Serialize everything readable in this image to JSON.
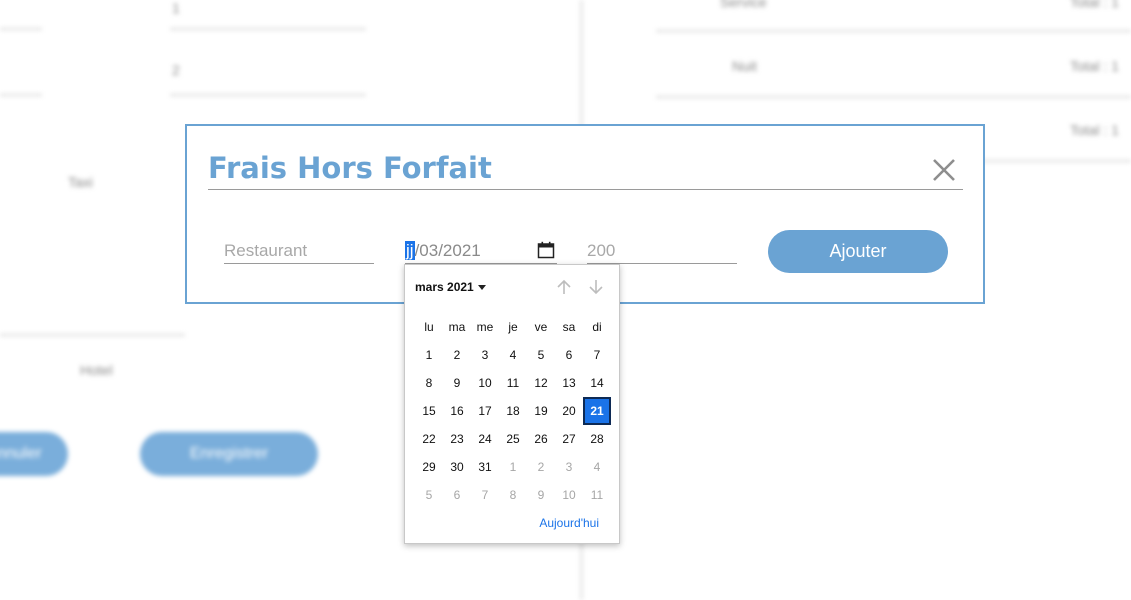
{
  "background": {
    "texts": [
      "1",
      "2",
      "Taxi",
      "Hotel"
    ],
    "right_texts": [
      "Service",
      "Total : 1",
      "Nuit",
      "Total : 1",
      "Total : 1"
    ],
    "buttons": [
      "Annuler",
      "Enregistrer"
    ]
  },
  "dialog": {
    "title": "Frais Hors Forfait",
    "close_icon": "close-icon",
    "libelle_placeholder": "Restaurant",
    "date": {
      "day_segment": "jj",
      "rest": "/03/2021"
    },
    "montant_placeholder": "200",
    "add_label": "Ajouter",
    "accent_color": "#6aa3d3"
  },
  "datepicker": {
    "month_label": "mars 2021",
    "weekdays": [
      "lu",
      "ma",
      "me",
      "je",
      "ve",
      "sa",
      "di"
    ],
    "weeks": [
      [
        "1",
        "2",
        "3",
        "4",
        "5",
        "6",
        "7"
      ],
      [
        "8",
        "9",
        "10",
        "11",
        "12",
        "13",
        "14"
      ],
      [
        "15",
        "16",
        "17",
        "18",
        "19",
        "20",
        "21"
      ],
      [
        "22",
        "23",
        "24",
        "25",
        "26",
        "27",
        "28"
      ],
      [
        "29",
        "30",
        "31",
        "1",
        "2",
        "3",
        "4"
      ],
      [
        "5",
        "6",
        "7",
        "8",
        "9",
        "10",
        "11"
      ]
    ],
    "selected_day": "21",
    "today_label": "Aujourd'hui",
    "selected_color": "#1a73e8"
  }
}
